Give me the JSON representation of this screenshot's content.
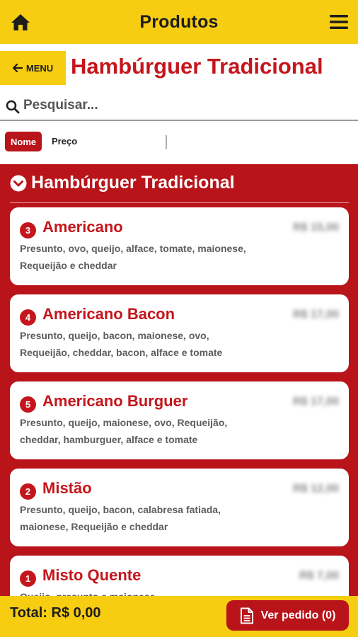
{
  "header": {
    "title": "Produtos",
    "home_icon": "home-icon",
    "menu_icon": "hamburger-menu-icon"
  },
  "subheader": {
    "back_label": "MENU",
    "back_icon": "arrow-left-icon",
    "title": "Hambúrguer Tradicional"
  },
  "search": {
    "placeholder": "Pesquisar...",
    "icon": "search-icon"
  },
  "sort": {
    "options": [
      "Nome",
      "Preço"
    ],
    "active": "Nome"
  },
  "section": {
    "title": "Hambúrguer Tradicional",
    "icon": "chevron-down-circle-icon"
  },
  "products": [
    {
      "number": "3",
      "name": "Americano",
      "price": "R$ 15,00",
      "description": "Presunto, ovo, queijo, alface, tomate, maionese, Requeijão e cheddar"
    },
    {
      "number": "4",
      "name": "Americano Bacon",
      "price": "R$ 17,00",
      "description": "Presunto, queijo, bacon, maionese, ovo, Requeijão, cheddar, bacon, alface e tomate"
    },
    {
      "number": "5",
      "name": "Americano Burguer",
      "price": "R$ 17,00",
      "description": "Presunto, queijo, maionese, ovo, Requeijão, cheddar, hamburguer, alface e tomate"
    },
    {
      "number": "2",
      "name": "Mistão",
      "price": "R$ 12,00",
      "description": "Presunto, queijo, bacon, calabresa fatiada, maionese, Requeijão e cheddar"
    },
    {
      "number": "1",
      "name": "Misto Quente",
      "price": "R$ 7,00",
      "description": "Queijo, presunto e maionese"
    }
  ],
  "footer": {
    "total": "Total: R$ 0,00",
    "order_label": "Ver pedido (0)",
    "order_icon": "document-icon"
  },
  "colors": {
    "yellow": "#f7cd12",
    "red": "#b8141a",
    "title_red": "#c4161c"
  }
}
